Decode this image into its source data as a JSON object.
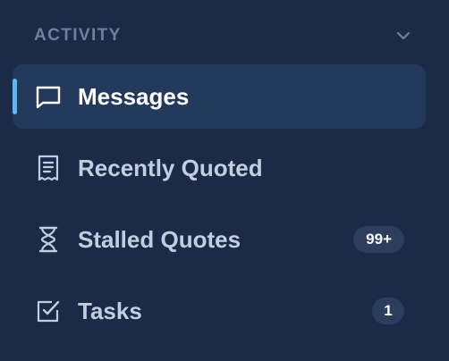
{
  "section": {
    "title": "ACTIVITY",
    "toggle_icon": "chevron-down-icon"
  },
  "colors": {
    "background": "#1a2a47",
    "active_background": "#243a5d",
    "active_indicator": "#5cb6f2",
    "badge_background": "#2d3e5c"
  },
  "nav": {
    "items": [
      {
        "label": "Messages",
        "icon": "message-square-icon",
        "active": true,
        "badge": ""
      },
      {
        "label": "Recently Quoted",
        "icon": "receipt-icon",
        "active": false,
        "badge": ""
      },
      {
        "label": "Stalled Quotes",
        "icon": "hourglass-icon",
        "active": false,
        "badge": "99+"
      },
      {
        "label": "Tasks",
        "icon": "check-square-icon",
        "active": false,
        "badge": "1"
      }
    ]
  }
}
